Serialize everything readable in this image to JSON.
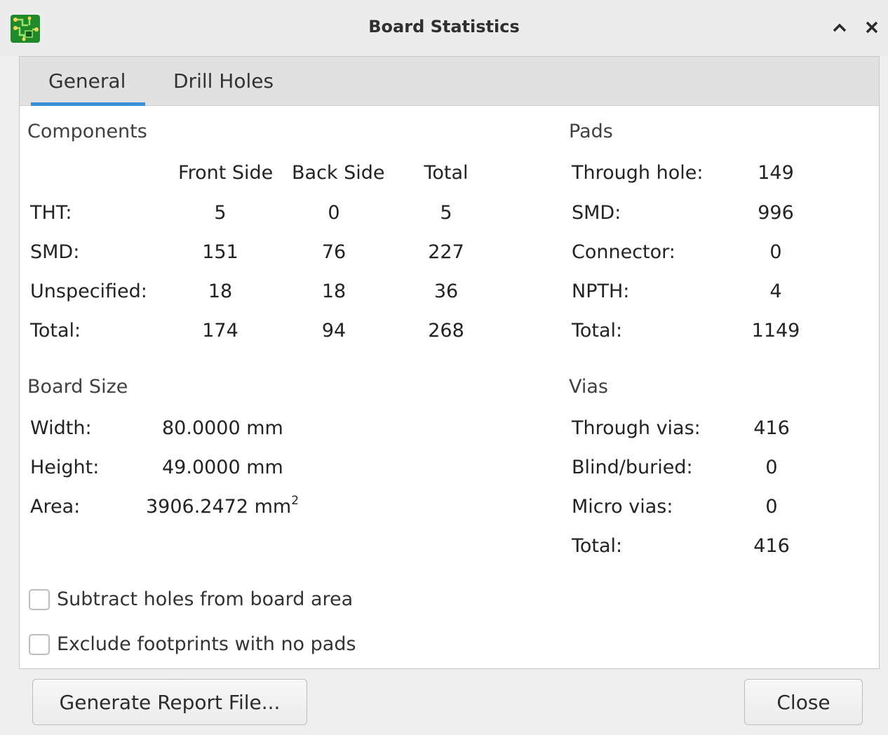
{
  "window": {
    "title": "Board Statistics",
    "icon": "pcb-app-icon",
    "controls": [
      "minimize-chevron-up-icon",
      "close-icon"
    ]
  },
  "tabs": [
    {
      "label": "General",
      "active": true
    },
    {
      "label": "Drill Holes",
      "active": false
    }
  ],
  "components": {
    "heading": "Components",
    "columns": [
      "Front Side",
      "Back Side",
      "Total"
    ],
    "rows": [
      {
        "label": "THT:",
        "front": "5",
        "back": "0",
        "total": "5"
      },
      {
        "label": "SMD:",
        "front": "151",
        "back": "76",
        "total": "227"
      },
      {
        "label": "Unspecified:",
        "front": "18",
        "back": "18",
        "total": "36"
      },
      {
        "label": "Total:",
        "front": "174",
        "back": "94",
        "total": "268"
      }
    ]
  },
  "pads": {
    "heading": "Pads",
    "rows": [
      {
        "label": "Through hole:",
        "value": "149"
      },
      {
        "label": "SMD:",
        "value": "996"
      },
      {
        "label": "Connector:",
        "value": "0"
      },
      {
        "label": "NPTH:",
        "value": "4"
      },
      {
        "label": "Total:",
        "value": "1149"
      }
    ]
  },
  "board_size": {
    "heading": "Board Size",
    "width_label": "Width:",
    "width_value": "80.0000 mm",
    "height_label": "Height:",
    "height_value": "49.0000 mm",
    "area_label": "Area:",
    "area_value": "3906.2472 mm",
    "area_sup": "2"
  },
  "vias": {
    "heading": "Vias",
    "rows": [
      {
        "label": "Through vias:",
        "value": "416"
      },
      {
        "label": "Blind/buried:",
        "value": "0"
      },
      {
        "label": "Micro vias:",
        "value": "0"
      },
      {
        "label": "Total:",
        "value": "416"
      }
    ]
  },
  "options": {
    "subtract_holes": {
      "label": "Subtract holes from board area",
      "checked": false
    },
    "exclude_footprints": {
      "label": "Exclude footprints with no pads",
      "checked": false
    }
  },
  "buttons": {
    "generate_report": "Generate Report File...",
    "close": "Close"
  },
  "colors": {
    "accent": "#3a8fd9",
    "pcb_green": "#1f8a2a"
  }
}
